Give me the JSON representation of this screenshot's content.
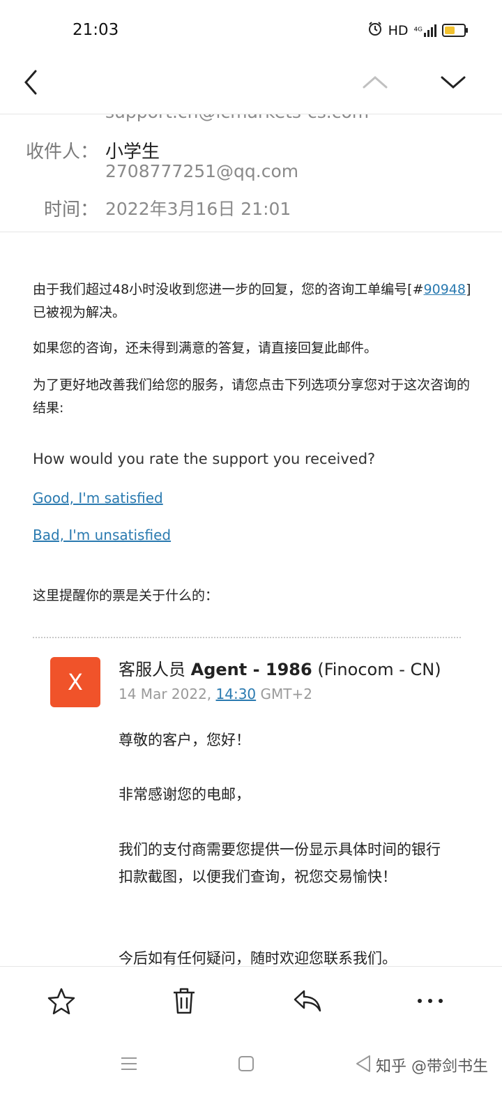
{
  "status_bar": {
    "time": "21:03",
    "network": "HD",
    "signal": "⁴ᴳ",
    "battery_level": 0.55
  },
  "header": {
    "from_partial": "support.cn@icmarkets-cs.com",
    "to_label": "收件人：",
    "to_name": "小学生",
    "to_email": "2708777251@qq.com",
    "time_label": "时间：",
    "time_value": "2022年3月16日 21:01"
  },
  "email": {
    "p1_before": "由于我们超过48小时没收到您进一步的回复，您的咨询工单编号[#",
    "ticket_number": "90948",
    "p1_after": "] 已被视为解决。",
    "p2": "如果您的咨询，还未得到满意的答复，请直接回复此邮件。",
    "p3": "为了更好地改善我们给您的服务，请您点击下列选项分享您对于这次咨询的结果:",
    "rating_question": "How would you rate the support you received?",
    "good_link": "Good, I'm satisfied",
    "bad_link": "Bad, I'm unsatisfied",
    "reminder": "这里提醒你的票是关于什么的："
  },
  "agent_message": {
    "avatar_letter": "X",
    "role": "客服人员",
    "agent_name": "Agent - 1986",
    "company": "(Finocom - CN)",
    "date": "14 Mar 2022,",
    "time_link": "14:30",
    "timezone": "GMT+2",
    "greeting": "尊敬的客户，您好！",
    "thanks": "非常感谢您的电邮，",
    "body": "我们的支付商需要您提供一份显示具体时间的银行扣款截图，以便我们查询，祝您交易愉快！",
    "closing": "今后如有任何疑问，随时欢迎您联系我们。"
  },
  "watermark": "知乎 @带剑书生",
  "colors": {
    "accent_link": "#2a7ab0",
    "avatar_bg": "#f0532a",
    "battery": "#f2c230"
  }
}
